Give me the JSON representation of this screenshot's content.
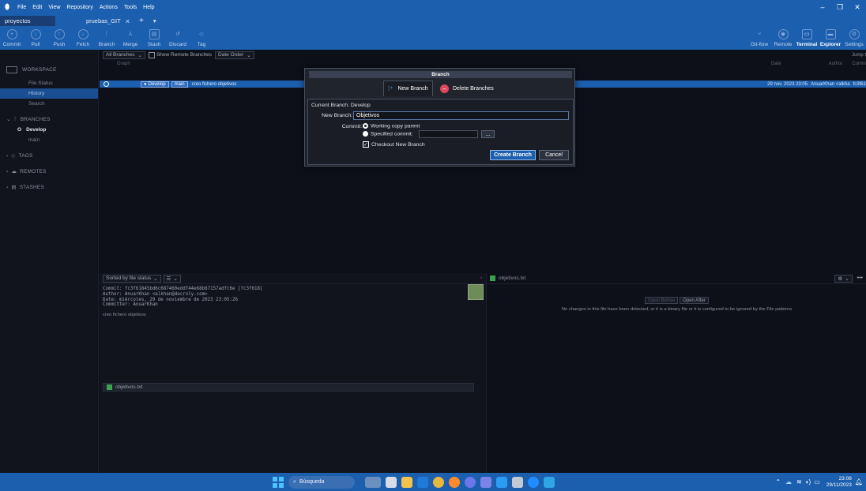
{
  "menu": {
    "items": [
      "File",
      "Edit",
      "View",
      "Repository",
      "Actions",
      "Tools",
      "Help"
    ]
  },
  "tabs": {
    "items": [
      "proyectos",
      "pruebas_GIT"
    ],
    "close": "×",
    "add": "+",
    "dropdown": "▾"
  },
  "toolbar": {
    "left": [
      {
        "label": "Commit",
        "icon": "commit-icon"
      },
      {
        "label": "Pull",
        "icon": "pull-icon"
      },
      {
        "label": "Push",
        "icon": "push-icon"
      },
      {
        "label": "Fetch",
        "icon": "fetch-icon"
      },
      {
        "label": "Branch",
        "icon": "branch-icon"
      },
      {
        "label": "Merge",
        "icon": "merge-icon"
      },
      {
        "label": "Stash",
        "icon": "stash-icon"
      },
      {
        "label": "Discard",
        "icon": "discard-icon"
      },
      {
        "label": "Tag",
        "icon": "tag-icon"
      }
    ],
    "right": [
      {
        "label": "Git-flow",
        "icon": "gitflow-icon"
      },
      {
        "label": "Remote",
        "icon": "remote-icon"
      },
      {
        "label": "Terminal",
        "icon": "terminal-icon"
      },
      {
        "label": "Explorer",
        "icon": "explorer-icon"
      },
      {
        "label": "Settings",
        "icon": "settings-icon"
      }
    ]
  },
  "sidebar": {
    "workspace": "WORKSPACE",
    "workspace_items": [
      "File Status",
      "History",
      "Search"
    ],
    "branches": "BRANCHES",
    "branch_items": [
      "Develop",
      "main"
    ],
    "current_branch_marker": "O",
    "tags": "TAGS",
    "remotes": "REMOTES",
    "stashes": "STASHES"
  },
  "filters": {
    "branches": "All Branches",
    "show_remote": "Show Remote Branches",
    "order": "Date Order",
    "jump": "Jump t"
  },
  "columns": {
    "graph": "Graph",
    "date": "Date",
    "author": "Author",
    "commit": "Comm"
  },
  "commit_row": {
    "branch_develop": "Develop",
    "branch_main": "main",
    "message": "creo fichero objetivos",
    "date": "29 nov. 2023 23:05",
    "author": "AnuarKhan <alkha",
    "hash": "fc3f61"
  },
  "details": {
    "sort": "Sorted by file status",
    "commit": "Commit: fc3f61845bd6c687460eddf44e68b67157adfc6e [fc3f618]",
    "author": "Author: AnuarKhan <alkhan@decroly.com>",
    "date": "Date: miércoles, 29 de noviembre de 2023 23:05:26",
    "committer": "Committer: AnuarKhan",
    "message": "creo fichero objetivos",
    "file": "objetivos.txt"
  },
  "diff": {
    "file": "objetivos.txt",
    "open_before": "Open Before",
    "open_after": "Open After",
    "notice": "No changes in this file have been detected, or it is a binary file or it is configured to be ignored by the File patterns",
    "more": "•••"
  },
  "dialog": {
    "title": "Branch",
    "tab_new": "New Branch",
    "tab_delete": "Delete Branches",
    "current_branch_label": "Current Branch:",
    "current_branch_value": "Develop",
    "new_branch_label": "New Branch:",
    "new_branch_value": "Objetivos",
    "commit_label": "Commit:",
    "opt_working": "Working copy parent",
    "opt_specified": "Specified commit:",
    "browse": "...",
    "checkout": "Checkout New Branch",
    "create": "Create Branch",
    "cancel": "Cancel"
  },
  "taskbar": {
    "search": "Búsqueda",
    "time": "23:08",
    "date": "29/11/2023"
  }
}
